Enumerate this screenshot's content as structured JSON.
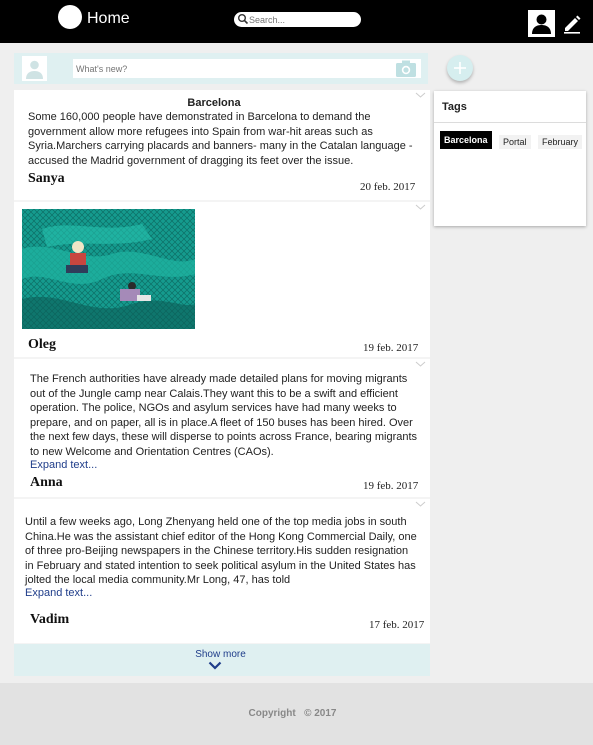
{
  "header": {
    "title": "Home",
    "search_placeholder": "Search..."
  },
  "composer": {
    "placeholder": "What's new?"
  },
  "posts": [
    {
      "title": "Barcelona",
      "body": "Some 160,000 people have demonstrated in Barcelona to demand the government allow more refugees into Spain from war-hit areas such as Syria.Marchers carrying placards and banners- many in the Catalan language - accused the Madrid government of dragging its feet over the issue.",
      "author": "Sanya",
      "date": "20 feb. 2017"
    },
    {
      "author": "Oleg",
      "date": "19 feb. 2017"
    },
    {
      "body": "The French authorities have already made detailed plans for moving migrants out of the Jungle camp near Calais.They want this to be a swift and efficient operation. The police, NGOs and asylum services have had many weeks to prepare, and on paper, all is in place.A fleet of 150 buses has been hired. Over the next few days, these will disperse to points across France, bearing migrants to new Welcome and Orientation Centres (CAOs).",
      "expand": "Expand text...",
      "author": "Anna",
      "date": "19 feb. 2017"
    },
    {
      "body": "Until a few weeks ago, Long Zhenyang held one of the top media jobs in south China.He was the assistant chief editor of the Hong Kong Commercial Daily, one of three pro-Beijing newspapers in the Chinese territory.His sudden resignation in February and stated intention to seek political asylum in the United States has jolted the local media community.Mr Long, 47, has told",
      "expand": "Expand text...",
      "author": "Vadim",
      "date": "17 feb. 2017"
    }
  ],
  "show_more": "Show more",
  "tags": {
    "header": "Tags",
    "items": [
      "Barcelona",
      "Portal",
      "February"
    ]
  },
  "footer": {
    "copyright": "Copyright   © 2017"
  },
  "colors": {
    "accent_light": "#dff0f1",
    "link": "#1f3d8a",
    "topbar": "#000000"
  }
}
